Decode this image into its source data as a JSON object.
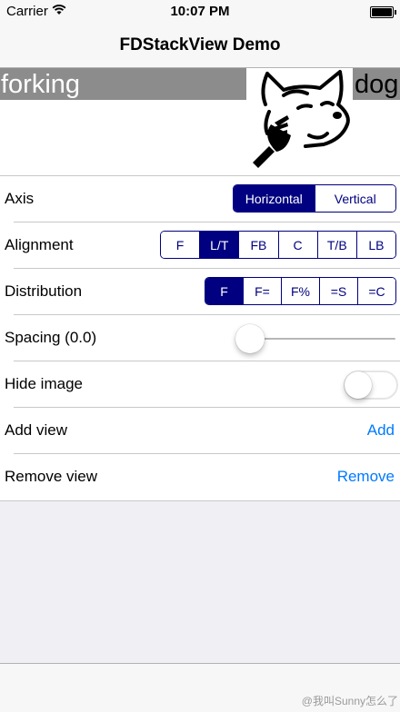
{
  "status_bar": {
    "carrier": "Carrier",
    "time": "10:07 PM",
    "wifi_icon": "wifi-icon",
    "battery_icon": "battery-icon"
  },
  "nav": {
    "title": "FDStackView Demo"
  },
  "stack": {
    "left_label": "forking",
    "right_label": "dog",
    "image_icon": "dog-with-fork-drawing"
  },
  "settings": {
    "axis": {
      "label": "Axis",
      "options": [
        "Horizontal",
        "Vertical"
      ],
      "selected": "Horizontal"
    },
    "alignment": {
      "label": "Alignment",
      "options": [
        "F",
        "L/T",
        "FB",
        "C",
        "T/B",
        "LB"
      ],
      "selected": "L/T"
    },
    "distribution": {
      "label": "Distribution",
      "options": [
        "F",
        "F=",
        "F%",
        "=S",
        "=C"
      ],
      "selected": "F"
    },
    "spacing": {
      "label": "Spacing (0.0)",
      "value": 0.0
    },
    "hide_image": {
      "label": "Hide image",
      "on": false
    },
    "add_view": {
      "label": "Add view",
      "button": "Add"
    },
    "remove_view": {
      "label": "Remove view",
      "button": "Remove"
    }
  },
  "colors": {
    "segment_tint": "#000080",
    "link": "#007aff",
    "label_bg": "#8c8c8c"
  },
  "watermark": "@我叫Sunny怎么了"
}
